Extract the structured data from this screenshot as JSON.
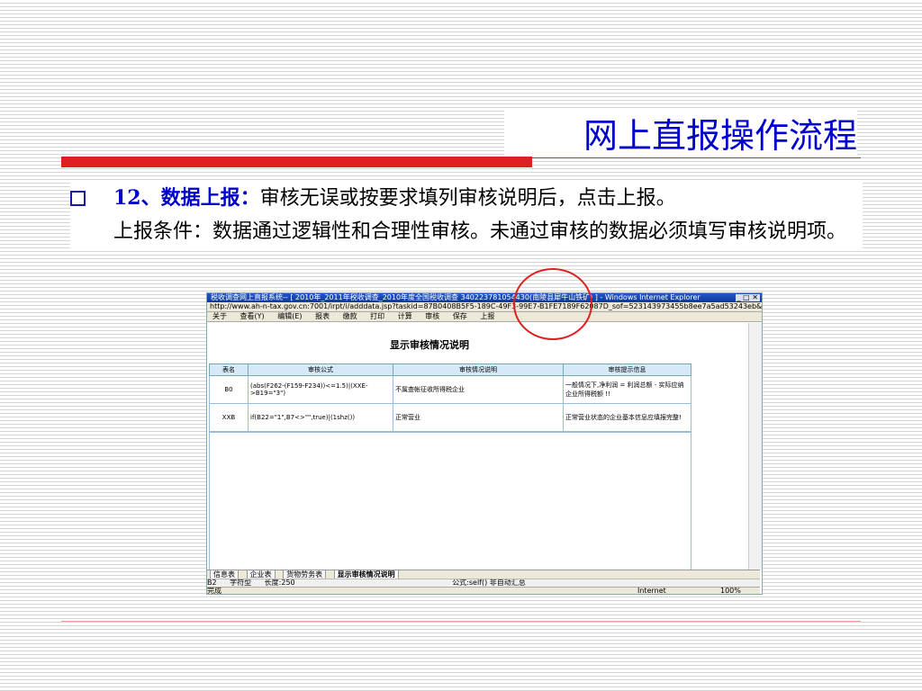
{
  "slide": {
    "title": "网上直报操作流程",
    "step_label": "12、数据上报：",
    "text1": "审核无误或按要求填列审核说明后，点击上报。",
    "text2": "上报条件：数据通过逻辑性和合理性审核。未通过审核的数据必须填写审核说明项。"
  },
  "browser": {
    "title": "税收调查网上直报系统-- [ 2010年_2011年税收调查_2010年度全国税收调查 340223781054430(南陵县犀牛山铁矿) ] - Windows Internet Explorer",
    "net_speed_1": "0KB/S",
    "net_speed_2": "0KB/S",
    "address": "http://www.ah-n-tax.gov.cn:7001/irpt/i/adddata.jsp?taskid=87B0408B5F5-189C-49F3-99E7-B1FE7189F62087D_sof=523143973455b8ee7a5ad53243eb&userid=340223781054430&btype=1",
    "menu": [
      "关于",
      "查看(Y)",
      "编辑(E)",
      "报表",
      "缴款",
      "打印",
      "计算",
      "审核",
      "保存",
      "上报"
    ]
  },
  "report": {
    "title": "显示审核情况说明",
    "headers": [
      "表名",
      "审核公式",
      "审核情况说明",
      "审核提示信息"
    ],
    "rows": [
      {
        "table": "B0",
        "formula": "(abs(F262-(F159-F234))<=1.5)|(XXE->B19=\"3\")",
        "explanation": "不属查帐征收所得税企业",
        "hint": "一般情况下,净利润 = 利润总额 - 实际应纳企业所得税额 !!"
      },
      {
        "table": "XXB",
        "formula": "if(B22=\"1\",B7<>\"\",true)|(1shz())",
        "explanation": "正常营业",
        "hint": "正常营业状态的企业基本信息应填报完整!"
      }
    ]
  },
  "sheets": [
    "信息表",
    "企业表",
    "货物劳务表",
    "显示审核情况说明"
  ],
  "formula_bar": {
    "cell": "B2",
    "type": "字符型",
    "length": "长度:250",
    "formula": "公式:self() 非自动汇总"
  },
  "statusbar": {
    "left": "完成",
    "zone": "Internet",
    "zoom": "100%"
  }
}
